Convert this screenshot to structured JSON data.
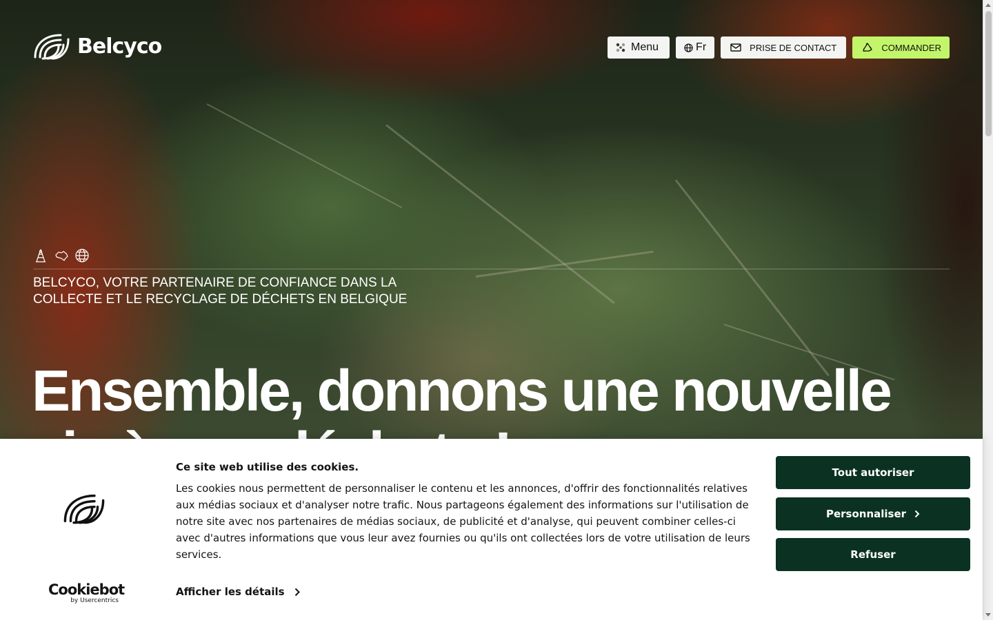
{
  "header": {
    "logo_text": "Belcyco",
    "nav": {
      "menu_label": "Menu",
      "language_label": "Fr",
      "contact_label": "PRISE DE CONTACT",
      "order_label": "COMMANDER"
    }
  },
  "hero": {
    "subtitle": "BELCYCO, VOTRE PARTENAIRE DE CONFIANCE DANS LA COLLECTE ET LE RECYCLAGE DE DÉCHETS EN BELGIQUE",
    "title": "Ensemble, donnons une nouvelle vie à nos déchets !",
    "icons": [
      "industry-icon",
      "belgium-map-icon",
      "globe-icon"
    ]
  },
  "cookie_banner": {
    "title": "Ce site web utilise des cookies.",
    "text": "Les cookies nous permettent de personnaliser le contenu et les annonces, d'offrir des fonctionnalités relatives aux médias sociaux et d'analyser notre trafic. Nous partageons également des informations sur l'utilisation de notre site avec nos partenaires de médias sociaux, de publicité et d'analyse, qui peuvent combiner celles-ci avec d'autres informations que vous leur avez fournies ou qu'ils ont collectées lors de votre utilisation de leurs services.",
    "details_label": "Afficher les détails",
    "allow_all_label": "Tout autoriser",
    "customize_label": "Personnaliser",
    "refuse_label": "Refuser",
    "provider_name": "Cookiebot",
    "provider_by": "by Usercentrics"
  },
  "colors": {
    "accent_green": "#c3f56a",
    "cookie_button": "#0b3122",
    "nav_button_bg": "#f4f4f2"
  }
}
